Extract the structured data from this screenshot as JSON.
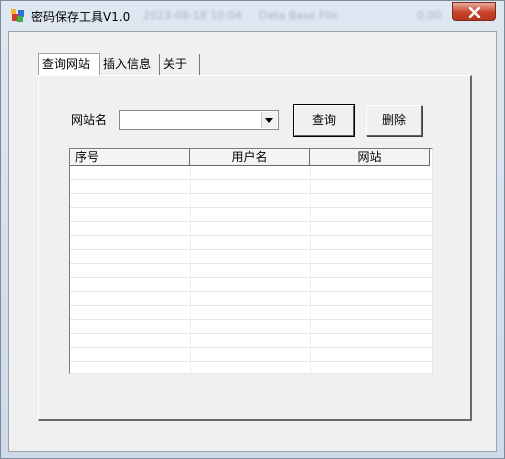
{
  "window": {
    "title": "密码保存工具V1.0",
    "blurred_title_parts": [
      "2023-08-18 10:04",
      "Data Base File",
      "0.00"
    ]
  },
  "tabs": [
    {
      "label": "查询网站",
      "active": true
    },
    {
      "label": "插入信息",
      "active": false
    },
    {
      "label": "关于",
      "active": false
    }
  ],
  "query_page": {
    "site_label": "网站名",
    "site_combo_value": "",
    "query_button": "查询",
    "delete_button": "删除",
    "table": {
      "columns": [
        "序号",
        "用户名",
        "网站"
      ],
      "rows": []
    }
  },
  "icons": {
    "app": "app-icon",
    "close": "close-icon",
    "dropdown": "chevron-down-icon"
  },
  "colors": {
    "close_button": "#c7432a",
    "client_background": "#f0f0f0"
  }
}
